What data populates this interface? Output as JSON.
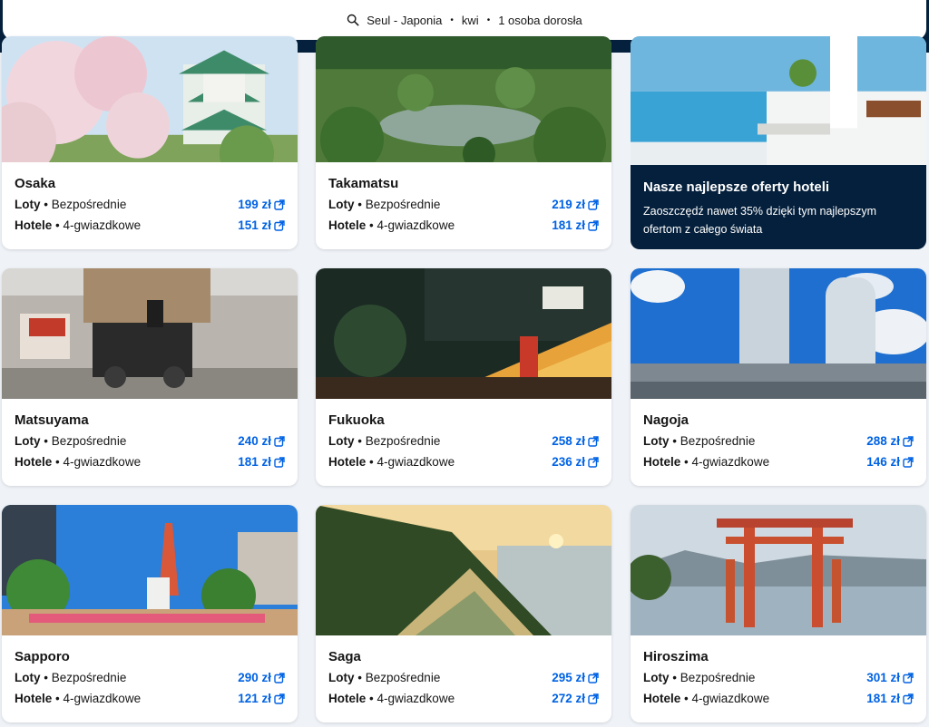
{
  "search": {
    "origin_dest": "Seul - Japonia",
    "month": "kwi",
    "travelers": "1 osoba dorosła"
  },
  "labels": {
    "flights": "Loty",
    "flights_sub": "Bezpośrednie",
    "hotels": "Hotele",
    "hotels_sub": "4-gwiazdkowe",
    "sep": "•"
  },
  "promo": {
    "title": "Nasze najlepsze oferty hoteli",
    "description": "Zaoszczędź nawet 35% dzięki tym najlepszym ofertom z całego świata"
  },
  "cards": [
    {
      "city": "Osaka",
      "flight_price": "199 zł",
      "hotel_price": "151 zł"
    },
    {
      "city": "Takamatsu",
      "flight_price": "219 zł",
      "hotel_price": "181 zł"
    },
    {
      "city": "Matsuyama",
      "flight_price": "240 zł",
      "hotel_price": "181 zł"
    },
    {
      "city": "Fukuoka",
      "flight_price": "258 zł",
      "hotel_price": "236 zł"
    },
    {
      "city": "Nagoja",
      "flight_price": "288 zł",
      "hotel_price": "146 zł"
    },
    {
      "city": "Sapporo",
      "flight_price": "290 zł",
      "hotel_price": "121 zł"
    },
    {
      "city": "Saga",
      "flight_price": "295 zł",
      "hotel_price": "272 zł"
    },
    {
      "city": "Hiroszima",
      "flight_price": "301 zł",
      "hotel_price": "181 zł"
    }
  ],
  "colors": {
    "header_bg": "#05203c",
    "accent": "#0062e3",
    "page_bg": "#eff3f8"
  }
}
